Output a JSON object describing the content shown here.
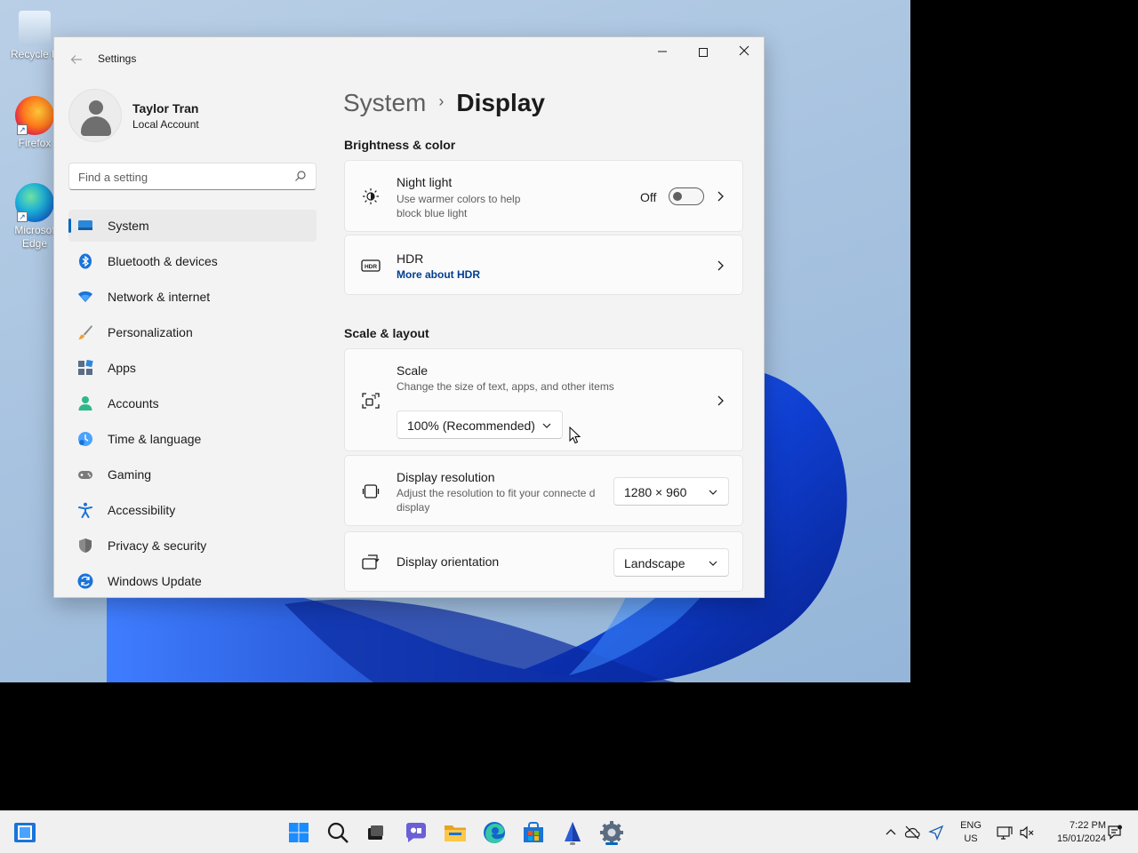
{
  "desktop": {
    "icons": [
      {
        "label": "Recycle Bin",
        "display": "Recycle B"
      },
      {
        "label": "Firefox",
        "display": "Firefox"
      },
      {
        "label": "Microsoft Edge",
        "display_line1": "Microsof",
        "display_line2": "Edge"
      }
    ]
  },
  "window": {
    "title": "Settings",
    "controls": {
      "minimize": "—",
      "close": "✕"
    }
  },
  "profile": {
    "name": "Taylor Tran",
    "account_type": "Local Account"
  },
  "search": {
    "placeholder": "Find a setting"
  },
  "nav": {
    "items": [
      {
        "label": "System",
        "icon": "system-icon",
        "active": true
      },
      {
        "label": "Bluetooth & devices",
        "icon": "bluetooth-icon"
      },
      {
        "label": "Network & internet",
        "icon": "network-icon"
      },
      {
        "label": "Personalization",
        "icon": "brush-icon"
      },
      {
        "label": "Apps",
        "icon": "apps-icon"
      },
      {
        "label": "Accounts",
        "icon": "accounts-icon"
      },
      {
        "label": "Time & language",
        "icon": "clock-icon"
      },
      {
        "label": "Gaming",
        "icon": "gamepad-icon"
      },
      {
        "label": "Accessibility",
        "icon": "accessibility-icon"
      },
      {
        "label": "Privacy & security",
        "icon": "shield-icon"
      },
      {
        "label": "Windows Update",
        "icon": "update-icon"
      }
    ]
  },
  "breadcrumb": {
    "parent": "System",
    "separator": "›",
    "current": "Display"
  },
  "sections": {
    "brightness": "Brightness & color",
    "scale_layout": "Scale & layout"
  },
  "night_light": {
    "title": "Night light",
    "description": "Use warmer colors to help block blue light",
    "toggle_state": "Off"
  },
  "hdr": {
    "title": "HDR",
    "link": "More about HDR"
  },
  "scale": {
    "title": "Scale",
    "description": "Change the size of text, apps, and other items",
    "value": "100% (Recommended)"
  },
  "resolution": {
    "title": "Display resolution",
    "description": "Adjust the resolution to fit your connecte d display",
    "value": "1280 × 960"
  },
  "orientation": {
    "title": "Display orientation",
    "value": "Landscape"
  },
  "taskbar": {
    "language": {
      "line1": "ENG",
      "line2": "US"
    },
    "clock": {
      "time": "7:22 PM",
      "date": "15/01/2024"
    }
  },
  "colors": {
    "accent": "#0067c0",
    "link": "#003e92"
  }
}
